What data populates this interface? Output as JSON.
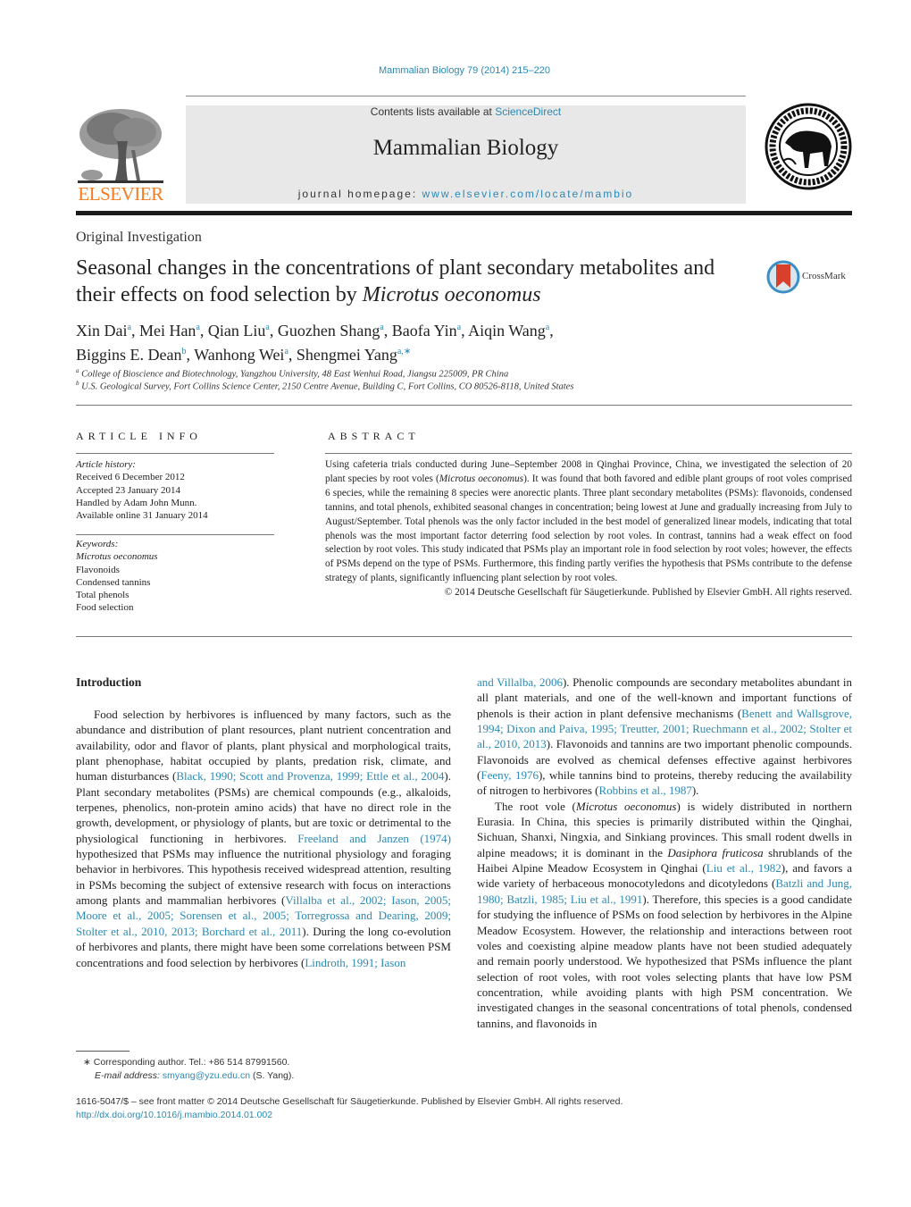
{
  "header": {
    "journal_reference": "Mammalian Biology 79 (2014) 215–220",
    "contents_prefix": "Contents lists available at ",
    "contents_link": "ScienceDirect",
    "journal_title": "Mammalian Biology",
    "homepage_prefix": "journal homepage: ",
    "homepage_link": "www.elsevier.com/locate/mambio",
    "publisher_logo_text": "ELSEVIER",
    "publisher_logo_icon": "elsevier-tree-logo",
    "society_logo_icon": "deutsche-gesellschaft-seal",
    "society_logo_text": "DEUTSCHE GESELLSCHAFT FÜR SÄUGETIERKUNDE E.V. BERLIN"
  },
  "article": {
    "section_type": "Original Investigation",
    "title_plain": "Seasonal changes in the concentrations of plant secondary metabolites and their effects on food selection by ",
    "title_italic": "Microtus oeconomus",
    "crossmark_label": "CrossMark",
    "authors": [
      {
        "name": "Xin Dai",
        "aff": "a",
        "sep": ", "
      },
      {
        "name": "Mei Han",
        "aff": "a",
        "sep": ", "
      },
      {
        "name": "Qian Liu",
        "aff": "a",
        "sep": ", "
      },
      {
        "name": "Guozhen Shang",
        "aff": "a",
        "sep": ", "
      },
      {
        "name": "Baofa Yin",
        "aff": "a",
        "sep": ", "
      },
      {
        "name": "Aiqin Wang",
        "aff": "a",
        "sep": ","
      },
      {
        "name": "Biggins E. Dean",
        "aff": "b",
        "sep": ", "
      },
      {
        "name": "Wanhong Wei",
        "aff": "a",
        "sep": ", "
      },
      {
        "name": "Shengmei Yang",
        "aff": "a,∗",
        "sep": ""
      }
    ],
    "affiliations": [
      {
        "key": "a",
        "text": "College of Bioscience and Biotechnology, Yangzhou University, 48 East Wenhui Road, Jiangsu 225009, PR China"
      },
      {
        "key": "b",
        "text": "U.S. Geological Survey, Fort Collins Science Center, 2150 Centre Avenue, Building C, Fort Collins, CO 80526-8118, United States"
      }
    ]
  },
  "article_info": {
    "heading": "ARTICLE INFO",
    "history_label": "Article history:",
    "history": [
      "Received 6 December 2012",
      "Accepted 23 January 2014",
      "Handled by Adam John Munn.",
      "Available online 31 January 2014"
    ],
    "keywords_label": "Keywords:",
    "keywords": [
      {
        "text": "Microtus oeconomus",
        "italic": true
      },
      {
        "text": "Flavonoids",
        "italic": false
      },
      {
        "text": "Condensed tannins",
        "italic": false
      },
      {
        "text": "Total phenols",
        "italic": false
      },
      {
        "text": "Food selection",
        "italic": false
      }
    ]
  },
  "abstract": {
    "heading": "ABSTRACT",
    "text_1": "Using cafeteria trials conducted during June–September 2008 in Qinghai Province, China, we investigated the selection of 20 plant species by root voles (",
    "text_italic": "Microtus oeconomus",
    "text_2": "). It was found that both favored and edible plant groups of root voles comprised 6 species, while the remaining 8 species were anorectic plants. Three plant secondary metabolites (PSMs): flavonoids, condensed tannins, and total phenols, exhibited seasonal changes in concentration; being lowest at June and gradually increasing from July to August/September. Total phenols was the only factor included in the best model of generalized linear models, indicating that total phenols was the most important factor deterring food selection by root voles. In contrast, tannins had a weak effect on food selection by root voles. This study indicated that PSMs play an important role in food selection by root voles; however, the effects of PSMs depend on the type of PSMs. Furthermore, this finding partly verifies the hypothesis that PSMs contribute to the defense strategy of plants, significantly influencing plant selection by root voles.",
    "copyright": "© 2014 Deutsche Gesellschaft für Säugetierkunde. Published by Elsevier GmbH. All rights reserved."
  },
  "introduction": {
    "heading": "Introduction",
    "left_column": [
      {
        "t": "Food selection by herbivores is influenced by many factors, such as the abundance and distribution of plant resources, plant nutrient concentration and availability, odor and flavor of plants, plant physical and morphological traits, plant phenophase, habitat occupied by plants, predation risk, climate, and human disturbances ("
      },
      {
        "t": "Black, 1990; Scott and Provenza, 1999; Ettle et al., 2004",
        "link": true
      },
      {
        "t": "). Plant secondary metabolites (PSMs) are chemical compounds (e.g., alkaloids, terpenes, phenolics, non-protein amino acids) that have no direct role in the growth, development, or physiology of plants, but are toxic or detrimental to the physiological functioning in herbivores. "
      },
      {
        "t": "Freeland and Janzen (1974)",
        "link": true
      },
      {
        "t": " hypothesized that PSMs may influence the nutritional physiology and foraging behavior in herbivores. This hypothesis received widespread attention, resulting in PSMs becoming the subject of extensive research with focus on interactions among plants and mammalian herbivores ("
      },
      {
        "t": "Villalba et al., 2002; Iason, 2005; Moore et al., 2005; Sorensen et al., 2005; Torregrossa and Dearing, 2009; Stolter et al., 2010, 2013; Borchard et al., 2011",
        "link": true
      },
      {
        "t": "). During the long co-evolution of herbivores and plants, there might have been some correlations between PSM concentrations and food selection by herbivores ("
      },
      {
        "t": "Lindroth, 1991; Iason",
        "link": true
      }
    ],
    "right_column_p1": [
      {
        "t": "and Villalba, 2006",
        "link": true
      },
      {
        "t": "). Phenolic compounds are secondary metabolites abundant in all plant materials, and one of the well-known and important functions of phenols is their action in plant defensive mechanisms ("
      },
      {
        "t": "Benett and Wallsgrove, 1994; Dixon and Paiva, 1995; Treutter, 2001; Ruechmann et al., 2002; Stolter et al., 2010, 2013",
        "link": true
      },
      {
        "t": "). Flavonoids and tannins are two important phenolic compounds. Flavonoids are evolved as chemical defenses effective against herbivores ("
      },
      {
        "t": "Feeny, 1976",
        "link": true
      },
      {
        "t": "), while tannins bind to proteins, thereby reducing the availability of nitrogen to herbivores ("
      },
      {
        "t": "Robbins et al., 1987",
        "link": true
      },
      {
        "t": ")."
      }
    ],
    "right_column_p2": [
      {
        "t": "The root vole ("
      },
      {
        "t": "Microtus oeconomus",
        "italic": true
      },
      {
        "t": ") is widely distributed in northern Eurasia. In China, this species is primarily distributed within the Qinghai, Sichuan, Shanxi, Ningxia, and Sinkiang provinces. This small rodent dwells in alpine meadows; it is dominant in the "
      },
      {
        "t": "Dasiphora fruticosa",
        "italic": true
      },
      {
        "t": " shrublands of the Haibei Alpine Meadow Ecosystem in Qinghai ("
      },
      {
        "t": "Liu et al., 1982",
        "link": true
      },
      {
        "t": "), and favors a wide variety of herbaceous monocotyledons and dicotyledons ("
      },
      {
        "t": "Batzli and Jung, 1980; Batzli, 1985; Liu et al., 1991",
        "link": true
      },
      {
        "t": "). Therefore, this species is a good candidate for studying the influence of PSMs on food selection by herbivores in the Alpine Meadow Ecosystem. However, the relationship and interactions between root voles and coexisting alpine meadow plants have not been studied adequately and remain poorly understood. We hypothesized that PSMs influence the plant selection of root voles, with root voles selecting plants that have low PSM concentration, while avoiding plants with high PSM concentration. We investigated changes in the seasonal concentrations of total phenols, condensed tannins, and flavonoids in"
      }
    ]
  },
  "footnote": {
    "marker": "∗",
    "text": "Corresponding author. Tel.: +86 514 87991560.",
    "email_label": "E-mail address: ",
    "email": "smyang@yzu.edu.cn",
    "email_suffix": " (S. Yang)."
  },
  "footer": {
    "issn_line": "1616-5047/$ – see front matter © 2014 Deutsche Gesellschaft für Säugetierkunde. Published by Elsevier GmbH. All rights reserved.",
    "doi": "http://dx.doi.org/10.1016/j.mambio.2014.01.002"
  },
  "colors": {
    "link": "#2a89b4",
    "elsevier_orange": "#f47b20",
    "band_gray": "#e8e8e8",
    "crossmark_red": "#d9402b",
    "crossmark_blue": "#3b8fc4"
  }
}
